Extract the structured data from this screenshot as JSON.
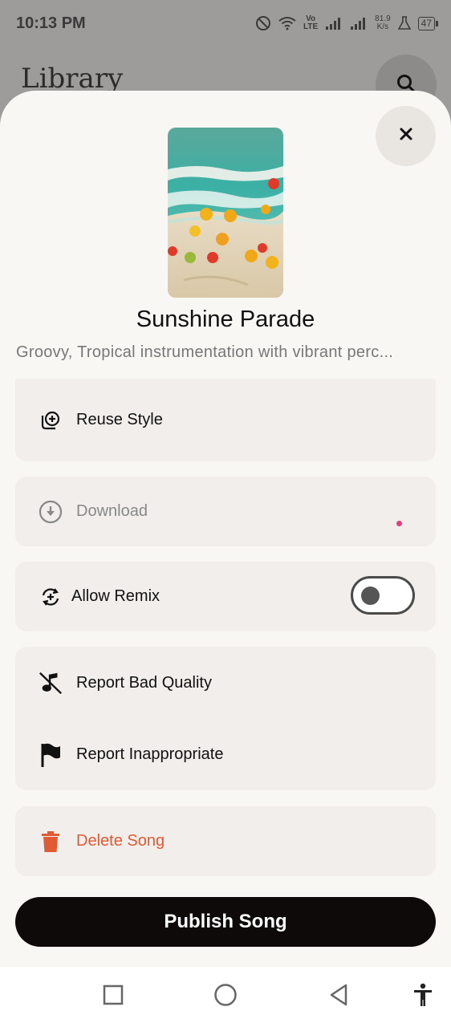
{
  "status_bar": {
    "time": "10:13 PM",
    "volte_top": "Vo",
    "volte_bottom": "LTE",
    "net_speed_value": "81.9",
    "net_speed_unit": "K/s",
    "battery": "47",
    "icons": [
      "do-not-disturb-icon",
      "wifi-icon",
      "signal-icon",
      "signal-icon",
      "battery-icon"
    ]
  },
  "background": {
    "title": "Library",
    "search_icon": "search-icon"
  },
  "sheet": {
    "close_icon": "close-icon",
    "song_title": "Sunshine Parade",
    "song_description": "Groovy, Tropical instrumentation with vibrant perc...",
    "options": {
      "reuse_style": "Reuse Style",
      "download": "Download",
      "allow_remix": "Allow Remix",
      "allow_remix_enabled": false,
      "report_bad_quality": "Report Bad Quality",
      "report_inappropriate": "Report Inappropriate",
      "delete_song": "Delete Song"
    },
    "publish_button": "Publish Song",
    "colors": {
      "delete": "#e05a33",
      "publish_bg": "#0e0a0a",
      "sheet_bg": "#f9f7f4"
    }
  },
  "nav_bar": {
    "icons": [
      "recents-square-icon",
      "home-circle-icon",
      "back-triangle-icon",
      "accessibility-icon"
    ]
  }
}
